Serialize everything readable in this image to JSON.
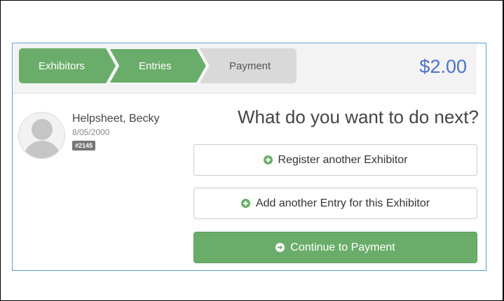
{
  "steps": [
    {
      "label": "Exhibitors",
      "state": "complete"
    },
    {
      "label": "Entries",
      "state": "complete"
    },
    {
      "label": "Payment",
      "state": "upcoming"
    }
  ],
  "total": "$2.00",
  "exhibitor": {
    "name": "Helpsheet, Becky",
    "dob": "8/05/2000",
    "id_badge": "#2145"
  },
  "headline": "What do you want to do next?",
  "actions": {
    "register_label": "Register another Exhibitor",
    "add_entry_label": "Add another Entry for this Exhibitor",
    "continue_label": "Continue to Payment"
  },
  "colors": {
    "step_active": "#6aad6a",
    "step_inactive": "#d9d9d9",
    "total_text": "#4a73c9",
    "primary_button": "#6aad6a"
  },
  "icons": {
    "register": "plus-circle-icon",
    "add_entry": "plus-circle-icon",
    "continue": "arrow-circle-right-icon"
  }
}
